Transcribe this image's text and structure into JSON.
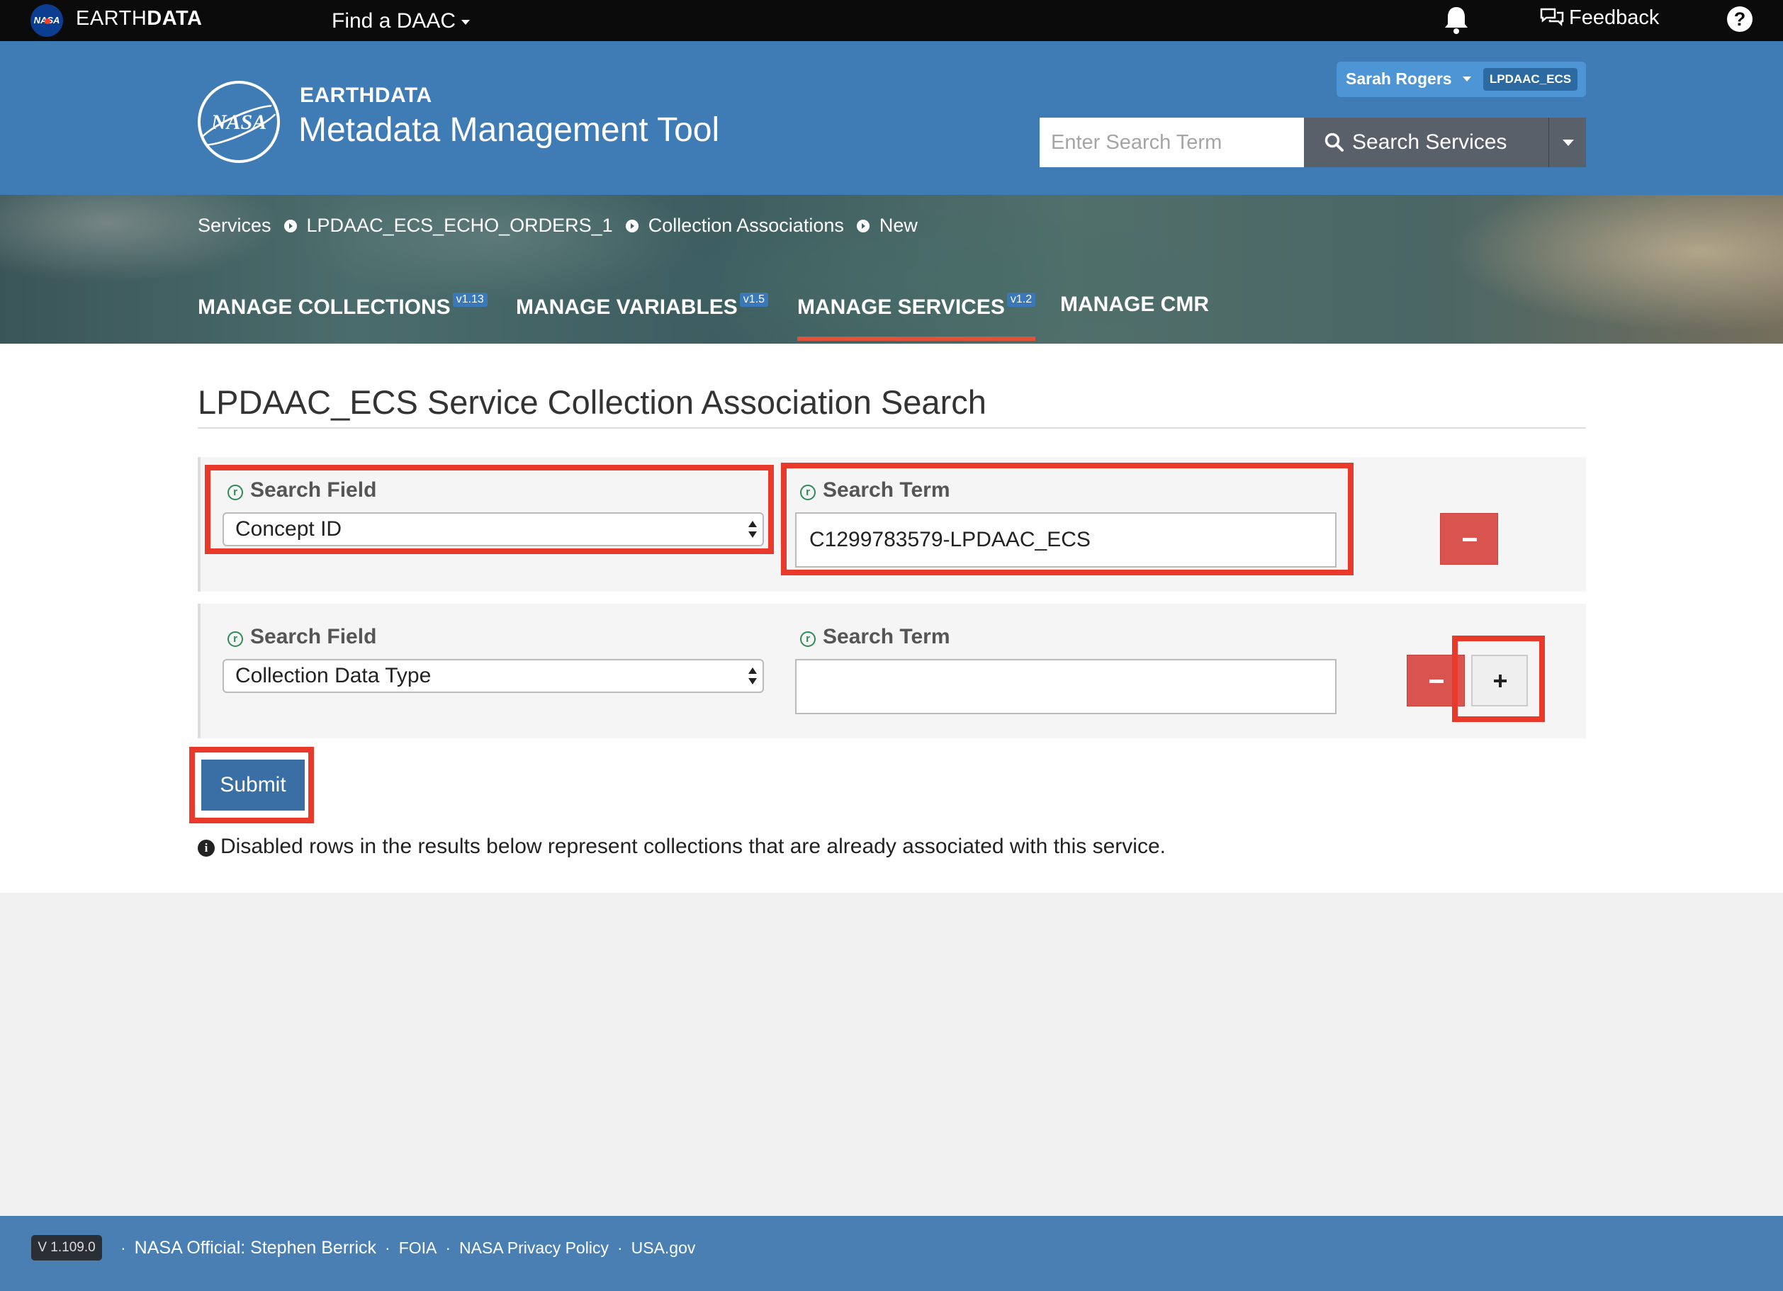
{
  "topbar": {
    "nasa_mini": "NASA",
    "brand_light": "EARTH",
    "brand_bold": "DATA",
    "find_daac": "Find a DAAC",
    "feedback": "Feedback",
    "help": "?"
  },
  "header": {
    "logo_text": "NASA",
    "org": "EARTHDATA",
    "app_title": "Metadata Management Tool",
    "user_name": "Sarah Rogers",
    "provider": "LPDAAC_ECS",
    "search_placeholder": "Enter Search Term",
    "search_button": "Search Services"
  },
  "breadcrumbs": [
    "Services",
    "LPDAAC_ECS_ECHO_ORDERS_1",
    "Collection Associations",
    "New"
  ],
  "tabs": [
    {
      "label": "MANAGE COLLECTIONS",
      "version": "v1.13"
    },
    {
      "label": "MANAGE VARIABLES",
      "version": "v1.5"
    },
    {
      "label": "MANAGE SERVICES",
      "version": "v1.2"
    },
    {
      "label": "MANAGE CMR",
      "version": ""
    }
  ],
  "main": {
    "title": "LPDAAC_ECS Service Collection Association Search",
    "rows": [
      {
        "field_label": "Search Field",
        "field_value": "Concept ID",
        "term_label": "Search Term",
        "term_value": "C1299783579-LPDAAC_ECS"
      },
      {
        "field_label": "Search Field",
        "field_value": "Collection Data Type",
        "term_label": "Search Term",
        "term_value": ""
      }
    ],
    "required_icon": "r",
    "submit": "Submit",
    "note": "Disabled rows in the results below represent collections that are already associated with this service.",
    "info_icon": "i"
  },
  "footer": {
    "version": "V 1.109.0",
    "official": "NASA Official: Stephen Berrick",
    "foia": "FOIA",
    "privacy": "NASA Privacy Policy",
    "usa": "USA.gov",
    "dot": "·"
  },
  "colors": {
    "header_blue": "#3f7bb5",
    "highlight_red": "#e8392b",
    "remove_red": "#d9534f",
    "submit_blue": "#3a6fa5",
    "required_green": "#2e8b57"
  },
  "icons": [
    "nasa-logo-icon",
    "caret-down-icon",
    "bell-icon",
    "feedback-icon",
    "help-icon",
    "search-icon",
    "chevron-right-icon",
    "required-icon",
    "minus-icon",
    "plus-icon",
    "info-icon"
  ]
}
